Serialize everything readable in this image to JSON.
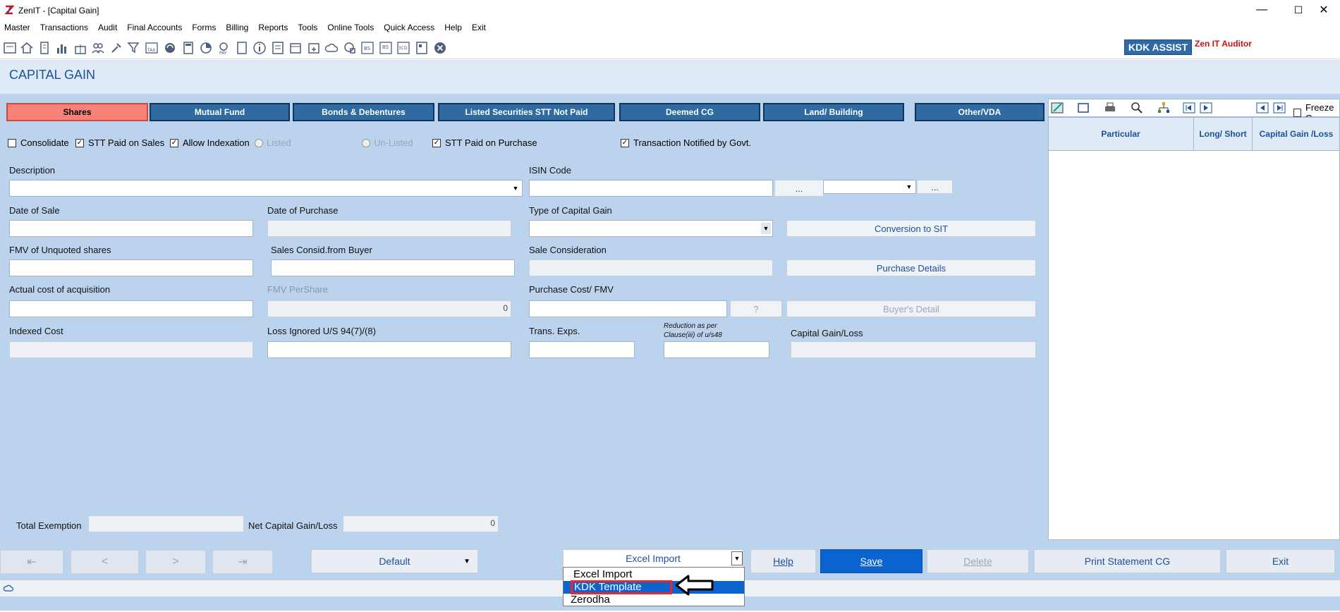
{
  "window": {
    "title": "ZenIT - [Capital Gain]",
    "minimize": "—",
    "maximize": "☐",
    "close": "✕"
  },
  "menu": [
    "Master",
    "Transactions",
    "Audit",
    "Final Accounts",
    "Forms",
    "Billing",
    "Reports",
    "Tools",
    "Online Tools",
    "Quick Access",
    "Help",
    "Exit"
  ],
  "toolbar": {
    "kdk_assist": "KDK ASSIST",
    "auditor": "Zen IT Auditor"
  },
  "page": {
    "title": "CAPITAL GAIN"
  },
  "tabs": [
    "Shares",
    "Mutual Fund",
    "Bonds & Debentures",
    "Listed Securities STT Not Paid",
    "Deemed CG",
    "Land/ Building",
    "Other/VDA"
  ],
  "options": {
    "consolidate": "Consolidate",
    "stt_sales": "STT Paid on Sales",
    "allow_indexation": "Allow Indexation",
    "listed": "Listed",
    "unlisted": "Un-Listed",
    "stt_purchase": "STT Paid on Purchase",
    "notified": "Transaction Notified by Govt.",
    "check": "✓"
  },
  "form": {
    "description": "Description",
    "isin": "ISIN Code",
    "isin_btn1": "...",
    "isin_btn2": "...",
    "date_sale": "Date of Sale",
    "date_purchase": "Date of Purchase",
    "type_cg": "Type of Capital Gain",
    "conversion_sit": "Conversion to SIT",
    "fmv_unquoted": "FMV of Unquoted shares",
    "sales_consid_buyer": "Sales Consid.from Buyer",
    "sale_consideration": "Sale Consideration",
    "purchase_details": "Purchase Details",
    "actual_cost": "Actual cost of acquisition",
    "fmv_pershare": "FMV PerShare",
    "fmv_pershare_value": "0",
    "purchase_cost_fmv": "Purchase Cost/ FMV",
    "q_btn": "?",
    "buyers_detail": "Buyer's Detail",
    "indexed_cost": "Indexed Cost",
    "loss_ignored": "Loss Ignored U/S 94(7)/(8)",
    "trans_exps": "Trans. Exps.",
    "reduction_line1": "Reduction as per",
    "reduction_line2": "Clause(iii) of u/s48",
    "capital_gain_loss": "Capital Gain/Loss",
    "total_exemption": "Total Exemption",
    "net_cg": "Net Capital Gain/Loss",
    "net_cg_value": "0"
  },
  "right_panel": {
    "freeze": "Freeze C",
    "headers": [
      "Particular",
      "Long/ Short",
      "Capital Gain /Loss"
    ]
  },
  "bottom": {
    "first": "⇤",
    "prev": "<",
    "next": ">",
    "last": "⇥",
    "default": "Default",
    "import_selected": "Excel Import",
    "import_options": [
      "Excel Import",
      "KDK Template",
      "Zerodha"
    ],
    "help": "Help",
    "save": "Save",
    "delete": "Delete",
    "print": "Print Statement CG",
    "exit": "Exit",
    "arrow": "▼"
  }
}
